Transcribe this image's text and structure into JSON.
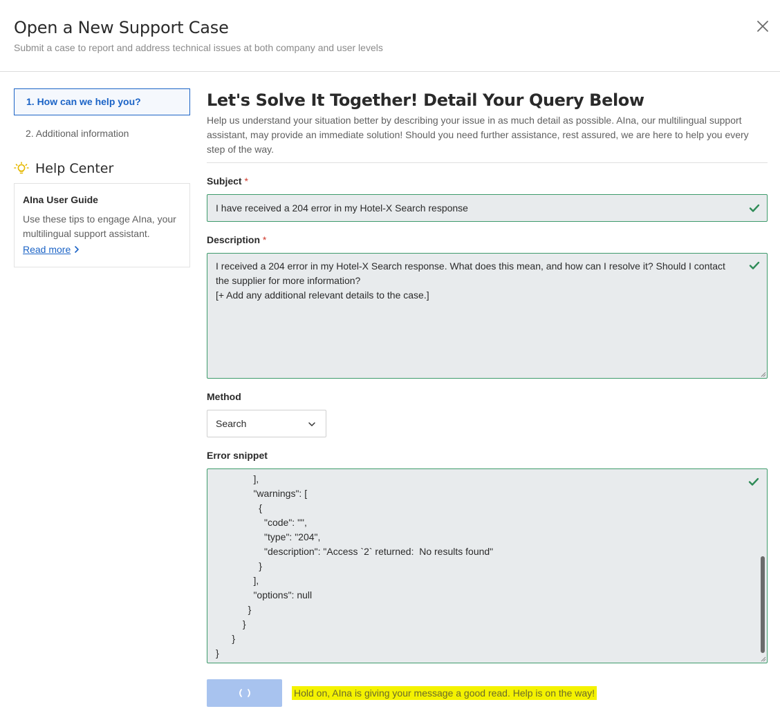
{
  "header": {
    "title": "Open a New Support Case",
    "subtitle": "Submit a case to report and address technical issues at both company and user levels",
    "close_icon": "close-icon"
  },
  "sidebar": {
    "steps": [
      {
        "label": "1. How can we help you?",
        "active": true
      },
      {
        "label": "2. Additional information",
        "active": false
      }
    ],
    "help_center": {
      "icon": "lightbulb-icon",
      "title": "Help Center",
      "card": {
        "title": "AIna User Guide",
        "text": "Use these tips to engage AIna, your multilingual support assistant.",
        "link": "Read more"
      }
    }
  },
  "main": {
    "title": "Let's Solve It Together! Detail Your Query Below",
    "intro": "Help us understand your situation better by describing your issue in as much detail as possible. AIna, our multilingual support assistant, may provide an immediate solution! Should you need further assistance, rest assured, we are here to help you every step of the way.",
    "subject": {
      "label": "Subject",
      "required_mark": "*",
      "value": "I have received a 204 error in my Hotel-X Search response"
    },
    "description": {
      "label": "Description",
      "required_mark": "*",
      "lines": [
        "I received a 204 error in my Hotel-X Search response. What does this mean, and how can I resolve it? Should I contact the supplier for more information?",
        "[+ Add any additional relevant details to the case.]"
      ]
    },
    "method": {
      "label": "Method",
      "selected": "Search"
    },
    "error_snippet": {
      "label": "Error snippet",
      "lines": [
        "              ],",
        "              \"warnings\": [",
        "                {",
        "                  \"code\": \"\",",
        "                  \"type\": \"204\",",
        "                  \"description\": \"Access `2` returned:  No results found\"",
        "                }",
        "              ],",
        "              \"options\": null",
        "            }",
        "          }",
        "      }",
        "}"
      ]
    },
    "status_message": "Hold on, AIna is giving your message a good read. Help is on the way!",
    "colors": {
      "accent": "#1b63c6",
      "valid_green": "#2e8b57",
      "highlight": "#f4f200",
      "button_disabled": "#a8c3ef"
    }
  }
}
